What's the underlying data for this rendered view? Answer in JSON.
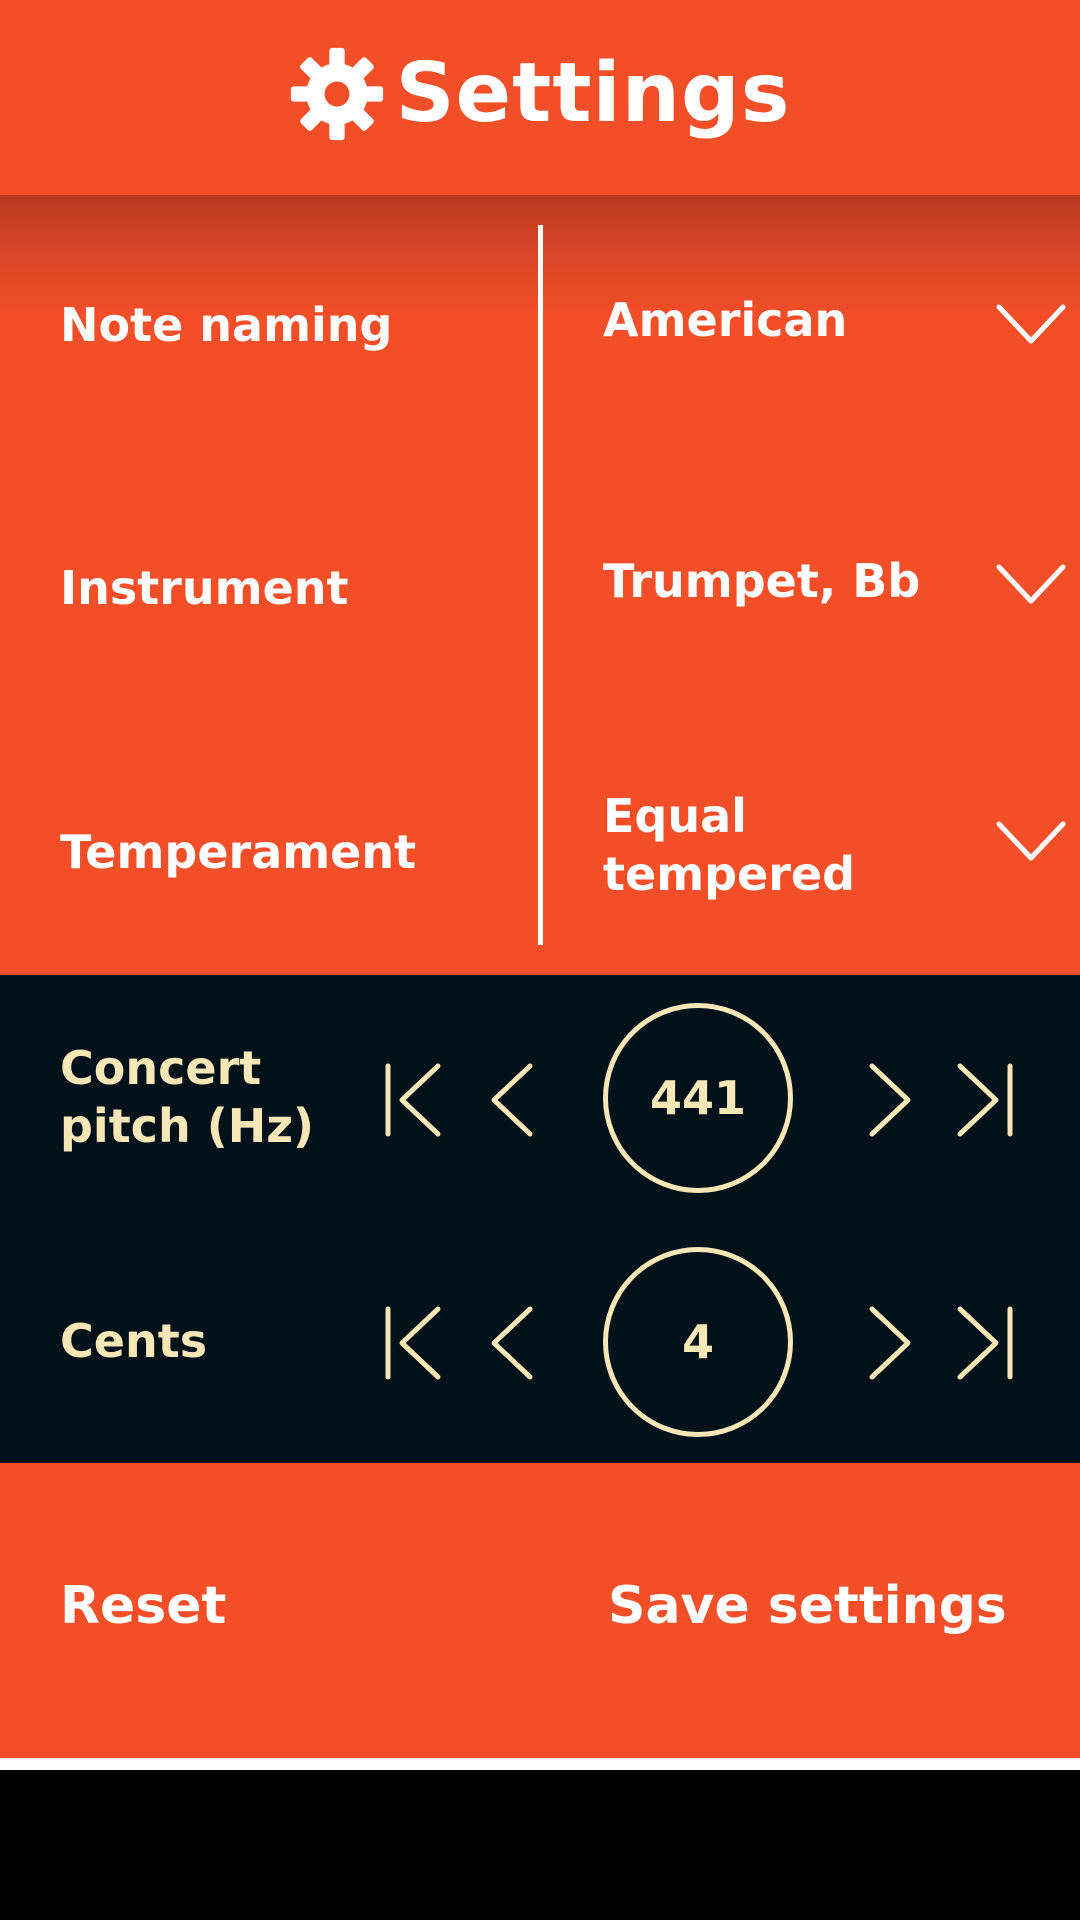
{
  "header": {
    "title": "Settings",
    "icon": "gear-icon"
  },
  "settings": {
    "note_naming": {
      "label": "Note naming",
      "value": "American"
    },
    "instrument": {
      "label": "Instrument",
      "value": "Trumpet, Bb"
    },
    "temperament": {
      "label": "Temperament",
      "value_line1": "Equal",
      "value_line2": "tempered"
    }
  },
  "steppers": {
    "concert_pitch": {
      "label_line1": "Concert",
      "label_line2": "pitch (Hz)",
      "value": "441"
    },
    "cents": {
      "label": "Cents",
      "value": "4"
    }
  },
  "actions": {
    "reset": "Reset",
    "save": "Save settings"
  },
  "colors": {
    "primary": "#F24E28",
    "dark": "#03111B",
    "accent_text": "#F7E6B6",
    "white": "#FFFFFF"
  }
}
